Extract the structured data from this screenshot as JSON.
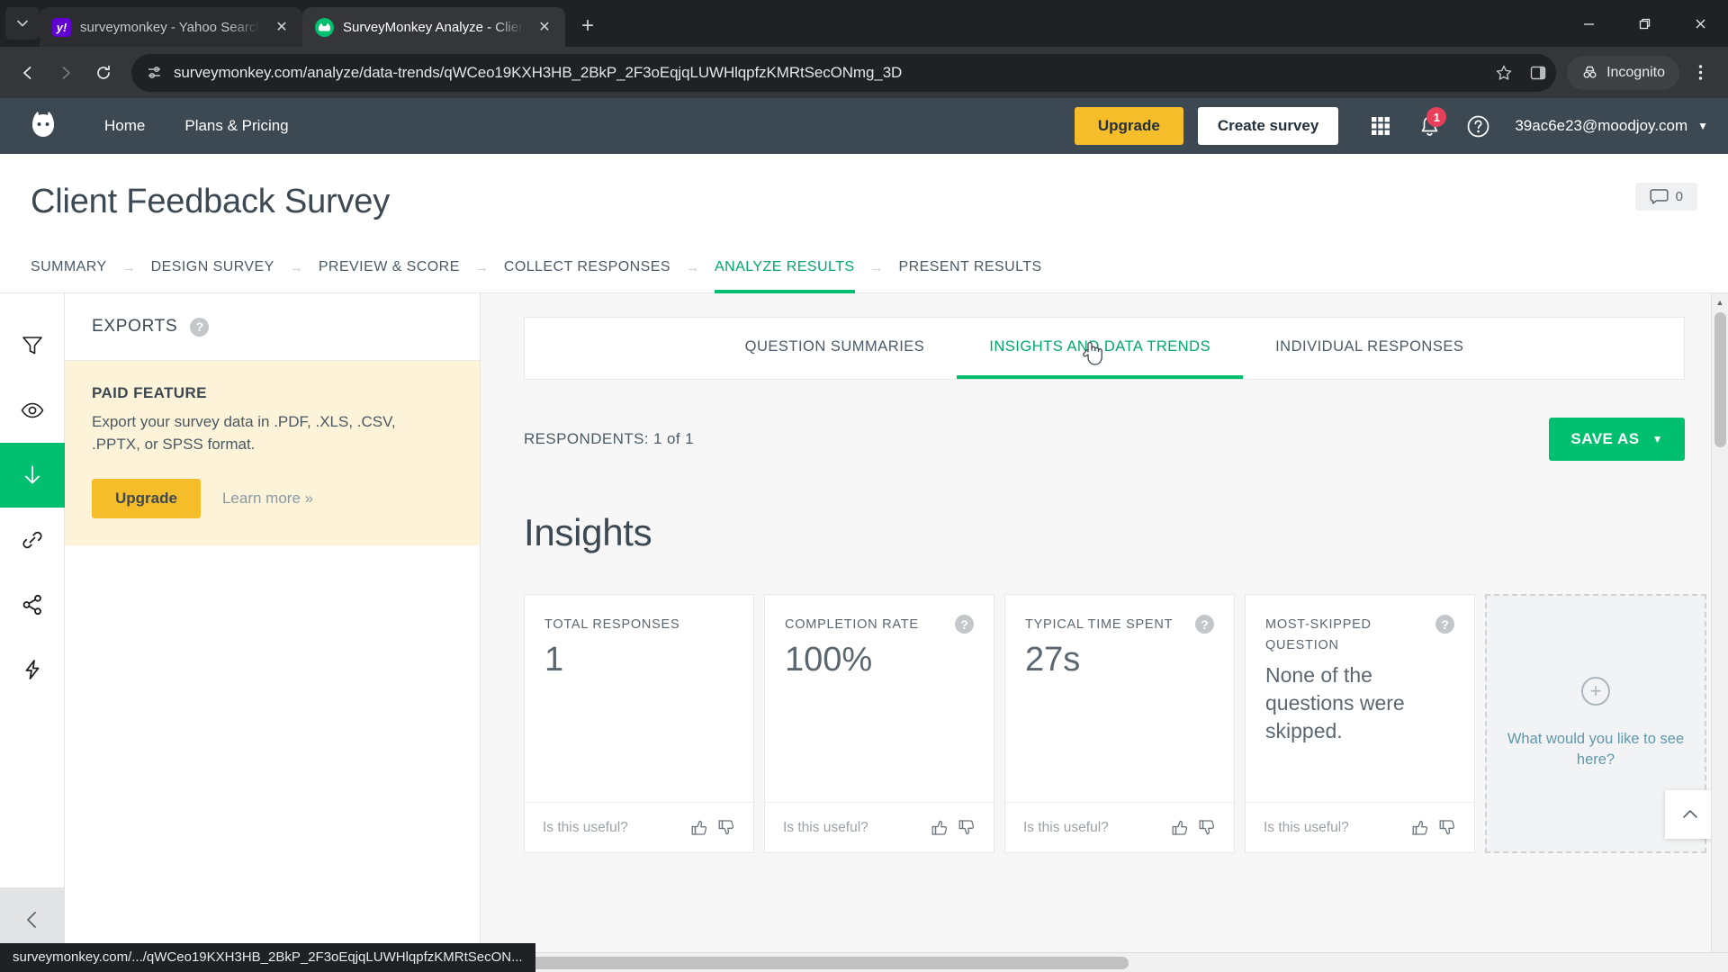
{
  "browser": {
    "tabs": [
      {
        "title": "surveymonkey - Yahoo Search R",
        "favicon": "yahoo-icon",
        "active": false
      },
      {
        "title": "SurveyMonkey Analyze - Client",
        "favicon": "surveymonkey-icon",
        "active": true
      }
    ],
    "new_tab_label": "+",
    "close_label": "✕",
    "url": "surveymonkey.com/analyze/data-trends/qWCeo19KXH3HB_2BkP_2F3oEqjqLUWHlqpfzKMRtSecONmg_3D",
    "incognito_label": "Incognito",
    "window_controls": {
      "minimize": "–",
      "maximize": "❐",
      "close": "✕"
    },
    "status_text": "surveymonkey.com/.../qWCeo19KXH3HB_2BkP_2F3oEqjqLUWHlqpfzKMRtSecON..."
  },
  "topnav": {
    "links": [
      "Home",
      "Plans & Pricing"
    ],
    "upgrade_label": "Upgrade",
    "create_survey_label": "Create survey",
    "notification_count": "1",
    "account_email": "39ac6e23@moodjoy.com",
    "account_caret": "▼",
    "colors": {
      "bar": "#3c4852",
      "upgrade": "#f5bd29",
      "badge": "#e8405a"
    }
  },
  "survey": {
    "title": "Client Feedback Survey",
    "comment_count": "0"
  },
  "steps": [
    {
      "label": "SUMMARY",
      "active": false
    },
    {
      "label": "DESIGN SURVEY",
      "active": false
    },
    {
      "label": "PREVIEW & SCORE",
      "active": false
    },
    {
      "label": "COLLECT RESPONSES",
      "active": false
    },
    {
      "label": "ANALYZE RESULTS",
      "active": true
    },
    {
      "label": "PRESENT RESULTS",
      "active": false
    }
  ],
  "rail": [
    {
      "name": "filter-icon",
      "active": false
    },
    {
      "name": "eye-icon",
      "active": false
    },
    {
      "name": "download-icon",
      "active": true
    },
    {
      "name": "link-icon",
      "active": false
    },
    {
      "name": "share-icon",
      "active": false
    },
    {
      "name": "bolt-icon",
      "active": false
    }
  ],
  "exports": {
    "header": "EXPORTS",
    "help_glyph": "?",
    "paid_label": "PAID FEATURE",
    "paid_desc": "Export your survey data in .PDF, .XLS, .CSV, .PPTX, or SPSS format.",
    "upgrade_label": "Upgrade",
    "learn_more_label": "Learn more »"
  },
  "subtabs": [
    {
      "label": "QUESTION SUMMARIES",
      "active": false
    },
    {
      "label": "INSIGHTS AND DATA TRENDS",
      "active": true
    },
    {
      "label": "INDIVIDUAL RESPONSES",
      "active": false
    }
  ],
  "toolbar": {
    "respondents": "RESPONDENTS: 1 of 1",
    "save_as_label": "SAVE AS",
    "save_as_caret": "▼"
  },
  "insights": {
    "heading": "Insights",
    "feedback_prompt": "Is this useful?",
    "cards": [
      {
        "label": "TOTAL RESPONSES",
        "value": "1",
        "has_help": false,
        "size": "large"
      },
      {
        "label": "COMPLETION RATE",
        "value": "100%",
        "has_help": true,
        "size": "large"
      },
      {
        "label": "TYPICAL TIME SPENT",
        "value": "27s",
        "has_help": true,
        "size": "large"
      },
      {
        "label": "MOST-SKIPPED QUESTION",
        "value": "None of the questions were skipped.",
        "has_help": true,
        "size": "small"
      }
    ],
    "add_card": {
      "plus_glyph": "+",
      "text": "What would you like to see here?"
    },
    "scroll_top_glyph": "⌃"
  }
}
